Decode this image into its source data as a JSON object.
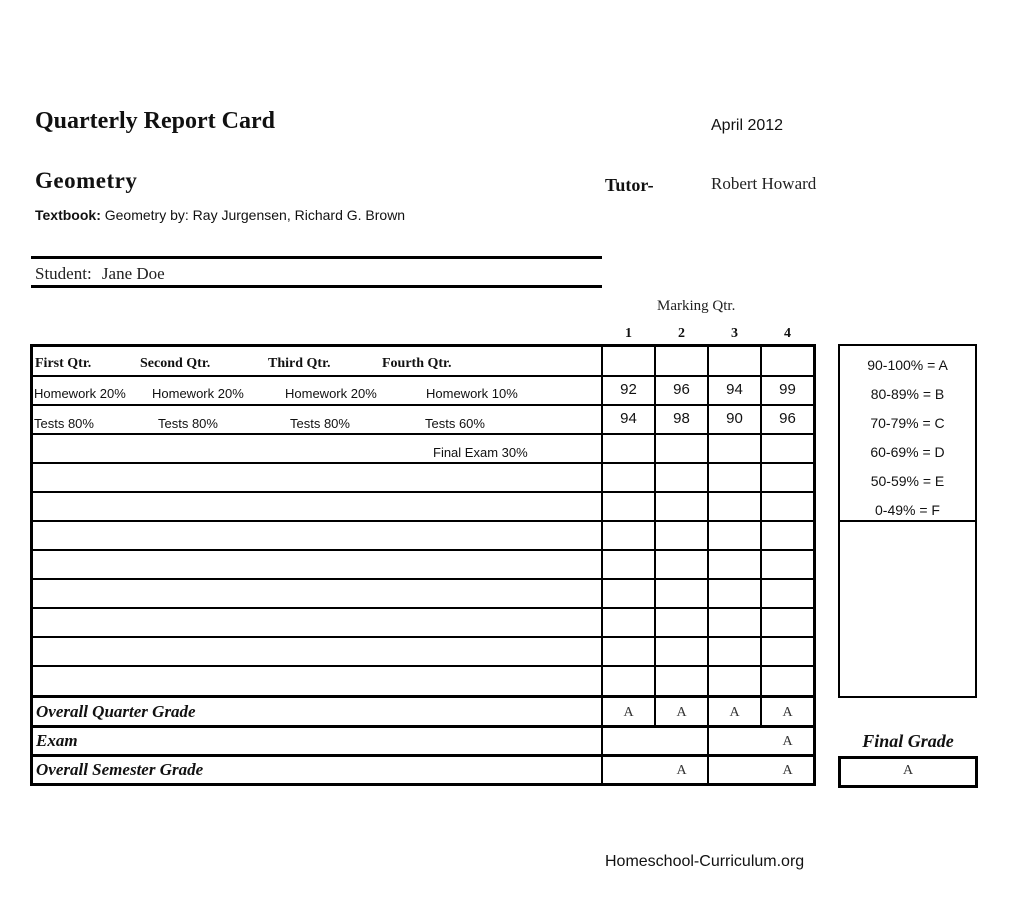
{
  "header": {
    "title": "Quarterly Report Card",
    "date": "April 2012",
    "subject": "Geometry",
    "tutor_label": "Tutor-",
    "tutor_name": "Robert Howard",
    "textbook_label": "Textbook:",
    "textbook_value": " Geometry by: Ray Jurgensen, Richard G. Brown"
  },
  "student": {
    "label": "Student:",
    "name": "Jane Doe"
  },
  "marking": {
    "label": "Marking Qtr.",
    "quarters": [
      "1",
      "2",
      "3",
      "4"
    ]
  },
  "categories": {
    "headers": [
      "First Qtr.",
      "Second Qtr.",
      "Third Qtr.",
      "Fourth Qtr."
    ],
    "homework": [
      "Homework 20%",
      "Homework 20%",
      "Homework 20%",
      "Homework 10%"
    ],
    "tests": [
      "Tests 80%",
      "Tests 80%",
      "Tests 80%",
      "Tests 60%"
    ],
    "final_exam": "Final Exam 30%"
  },
  "scores": {
    "homework": [
      "92",
      "96",
      "94",
      "99"
    ],
    "tests": [
      "94",
      "98",
      "90",
      "96"
    ]
  },
  "summary": {
    "overall_quarter_label": "Overall Quarter Grade",
    "overall_quarter_grades": [
      "A",
      "A",
      "A",
      "A"
    ],
    "exam_label": "Exam",
    "exam_grades": [
      "",
      "A"
    ],
    "overall_semester_label": "Overall Semester Grade",
    "overall_semester_grades": [
      "A",
      "A"
    ]
  },
  "grading_scale": [
    "90-100% = A",
    "80-89% = B",
    "70-79% = C",
    "60-69% = D",
    "50-59% = E",
    "0-49% = F"
  ],
  "final_grade": {
    "label": "Final Grade",
    "value": "A"
  },
  "footer": {
    "site": "Homeschool-Curriculum.org"
  }
}
